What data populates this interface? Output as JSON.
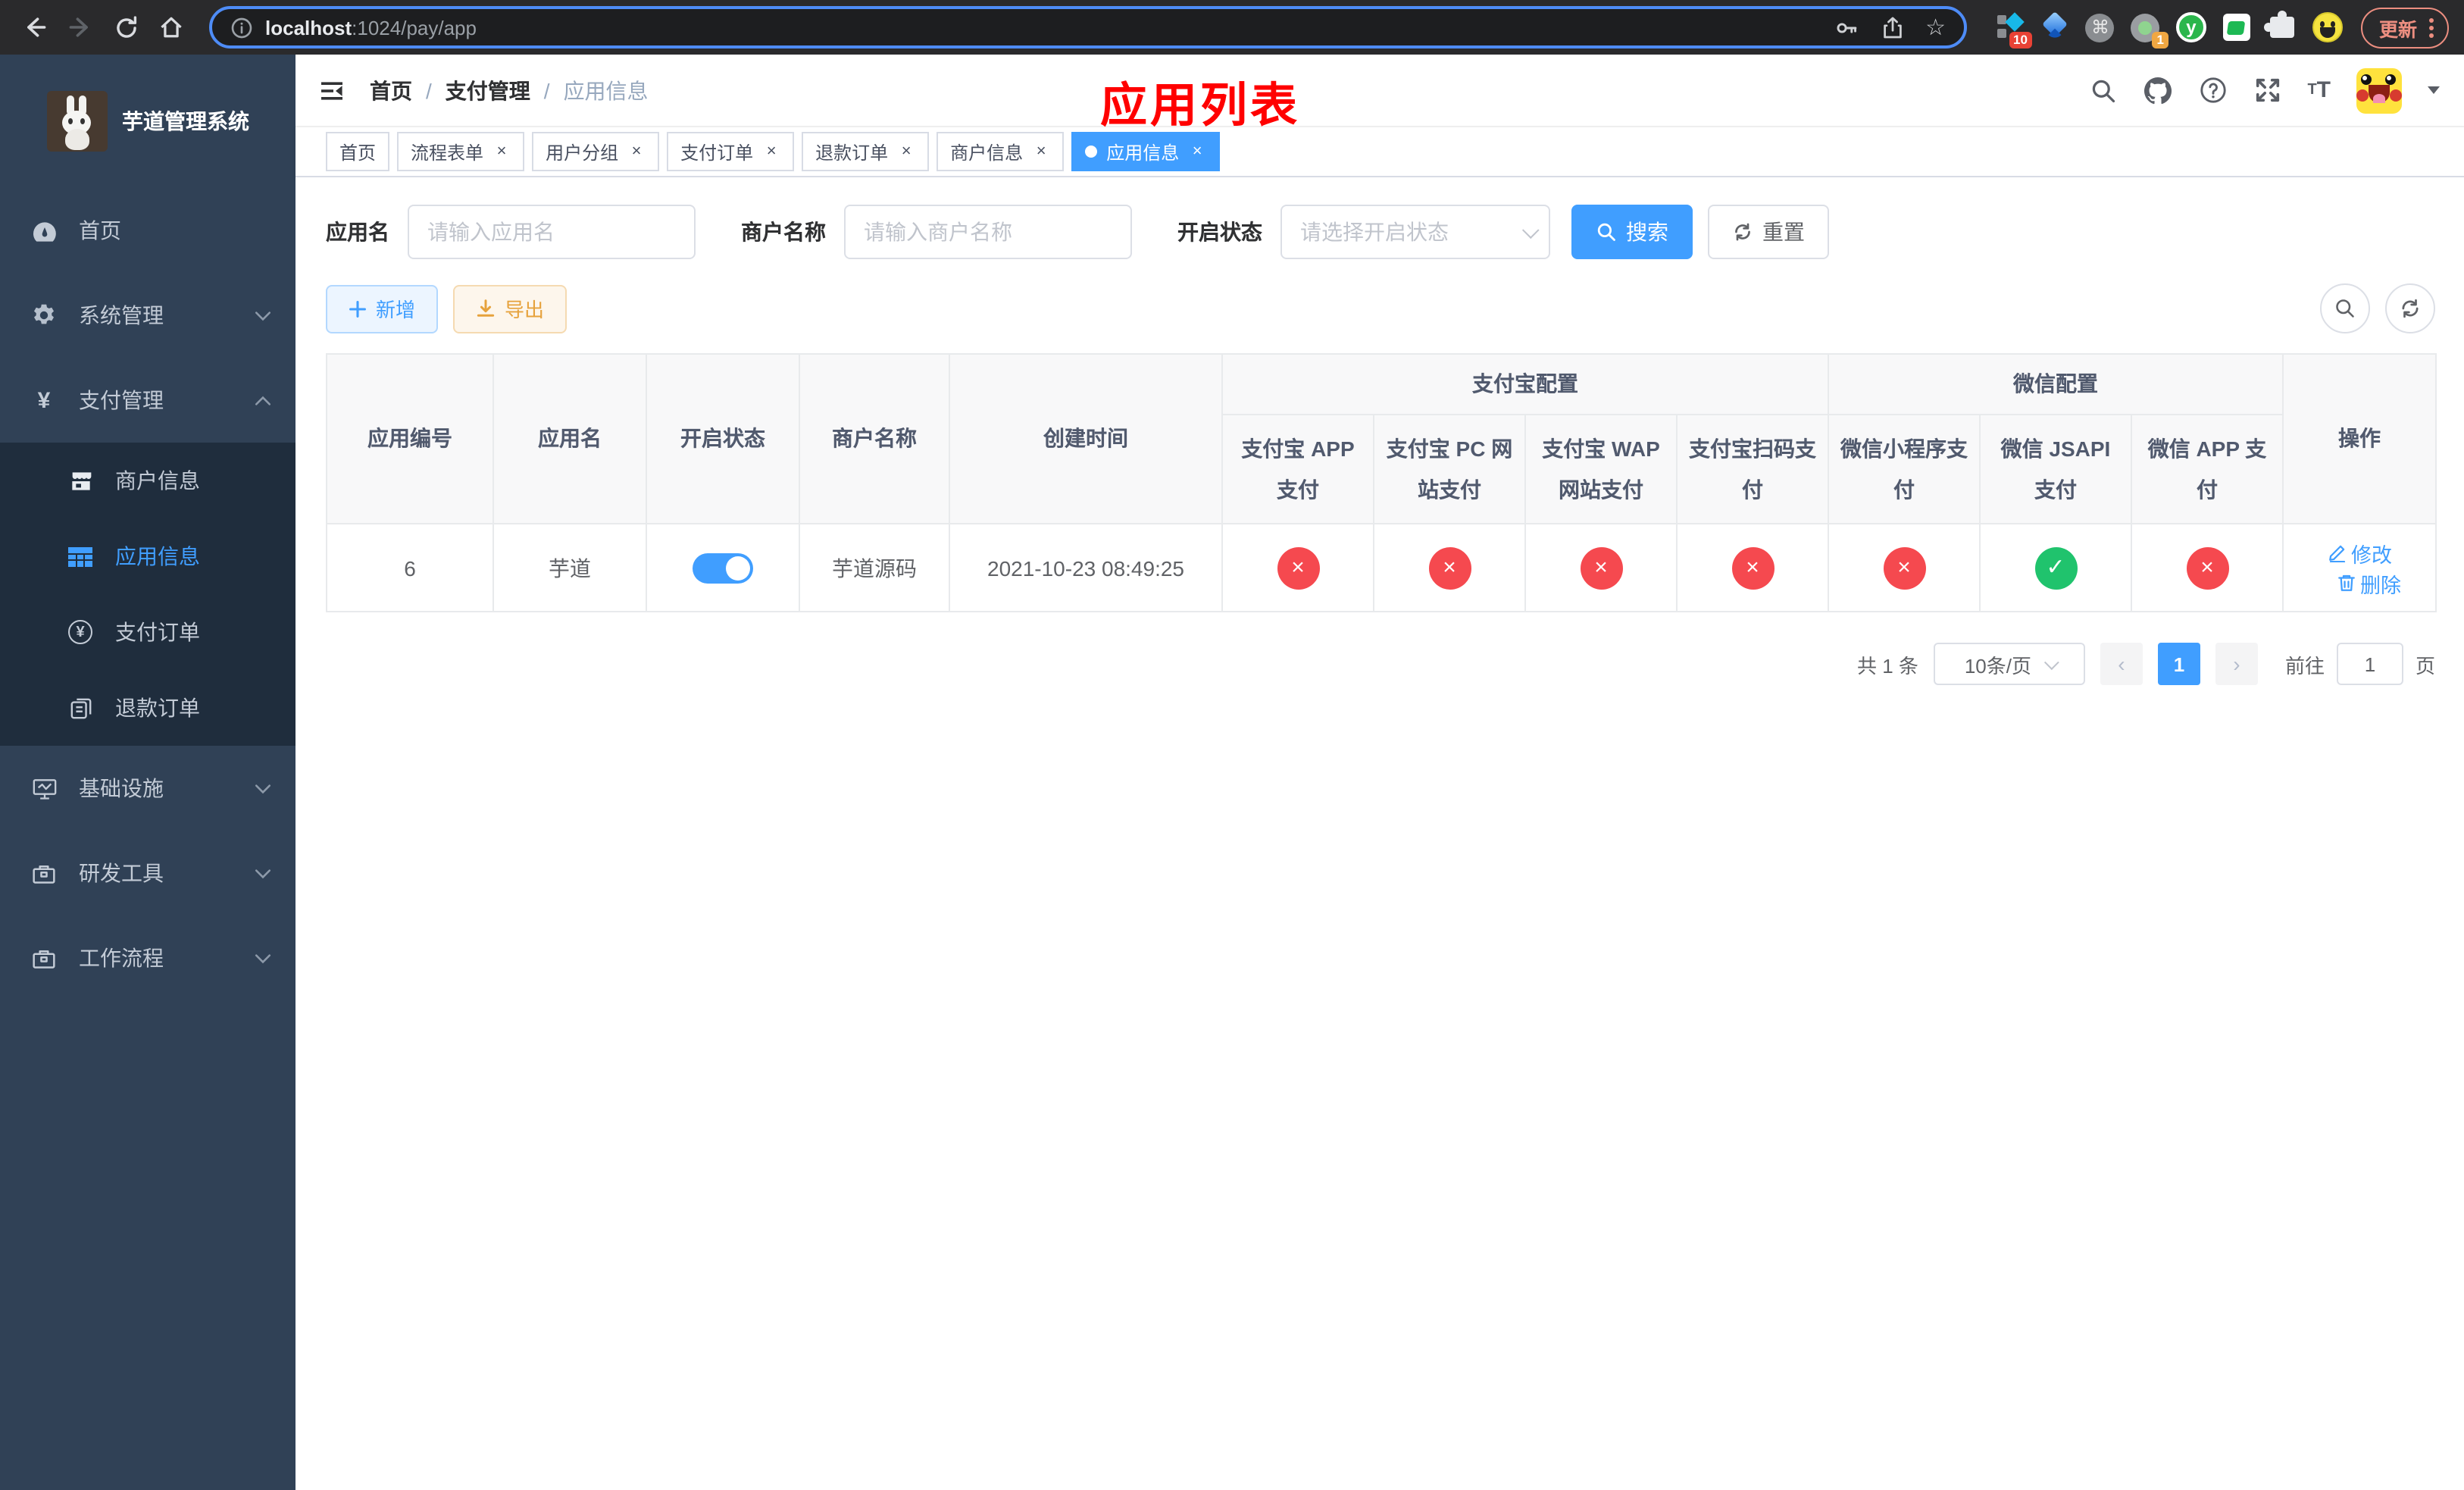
{
  "browser": {
    "url_host": "localhost",
    "url_rest": ":1024/pay/app",
    "update_label": "更新",
    "ext_badge_pin": "10",
    "ext_badge_rec": "1",
    "ext_letter": "y"
  },
  "sidebar": {
    "title": "芋道管理系统",
    "menu_home": "首页",
    "menu_system": "系统管理",
    "menu_pay": "支付管理",
    "sub_merchant": "商户信息",
    "sub_app": "应用信息",
    "sub_order": "支付订单",
    "sub_refund": "退款订单",
    "menu_infra": "基础设施",
    "menu_dev": "研发工具",
    "menu_flow": "工作流程"
  },
  "navbar": {
    "breadcrumb": [
      "首页",
      "支付管理",
      "应用信息"
    ]
  },
  "annotation": "应用列表",
  "tabs": [
    {
      "label": "首页"
    },
    {
      "label": "流程表单"
    },
    {
      "label": "用户分组"
    },
    {
      "label": "支付订单"
    },
    {
      "label": "退款订单"
    },
    {
      "label": "商户信息"
    },
    {
      "label": "应用信息"
    }
  ],
  "filters": {
    "app_name_label": "应用名",
    "app_name_placeholder": "请输入应用名",
    "merchant_label": "商户名称",
    "merchant_placeholder": "请输入商户名称",
    "status_label": "开启状态",
    "status_placeholder": "请选择开启状态",
    "search_label": "搜索",
    "reset_label": "重置"
  },
  "toolbar": {
    "add_label": "新增",
    "export_label": "导出"
  },
  "table": {
    "groups": {
      "alipay": "支付宝配置",
      "wechat": "微信配置"
    },
    "columns": [
      "应用编号",
      "应用名",
      "开启状态",
      "商户名称",
      "创建时间",
      "支付宝 APP 支付",
      "支付宝 PC 网站支付",
      "支付宝 WAP 网站支付",
      "支付宝扫码支付",
      "微信小程序支付",
      "微信 JSAPI 支付",
      "微信 APP 支付",
      "操作"
    ],
    "row": {
      "id": "6",
      "name": "芋道",
      "enabled": true,
      "merchant": "芋道源码",
      "created": "2021-10-23 08:49:25",
      "pay_status": [
        false,
        false,
        false,
        false,
        false,
        true,
        false
      ],
      "edit_label": "修改",
      "delete_label": "删除"
    }
  },
  "pagination": {
    "total": "共 1 条",
    "page_size": "10条/页",
    "current": "1",
    "goto_label": "前往",
    "goto_value": "1",
    "page_label": "页"
  },
  "colors": {
    "primary": "#409eff",
    "danger": "#f5494f",
    "success": "#20c36d",
    "annotation_red": "#ff0000",
    "sidebar_bg": "#304156",
    "submenu_bg": "#1f2d3d"
  }
}
